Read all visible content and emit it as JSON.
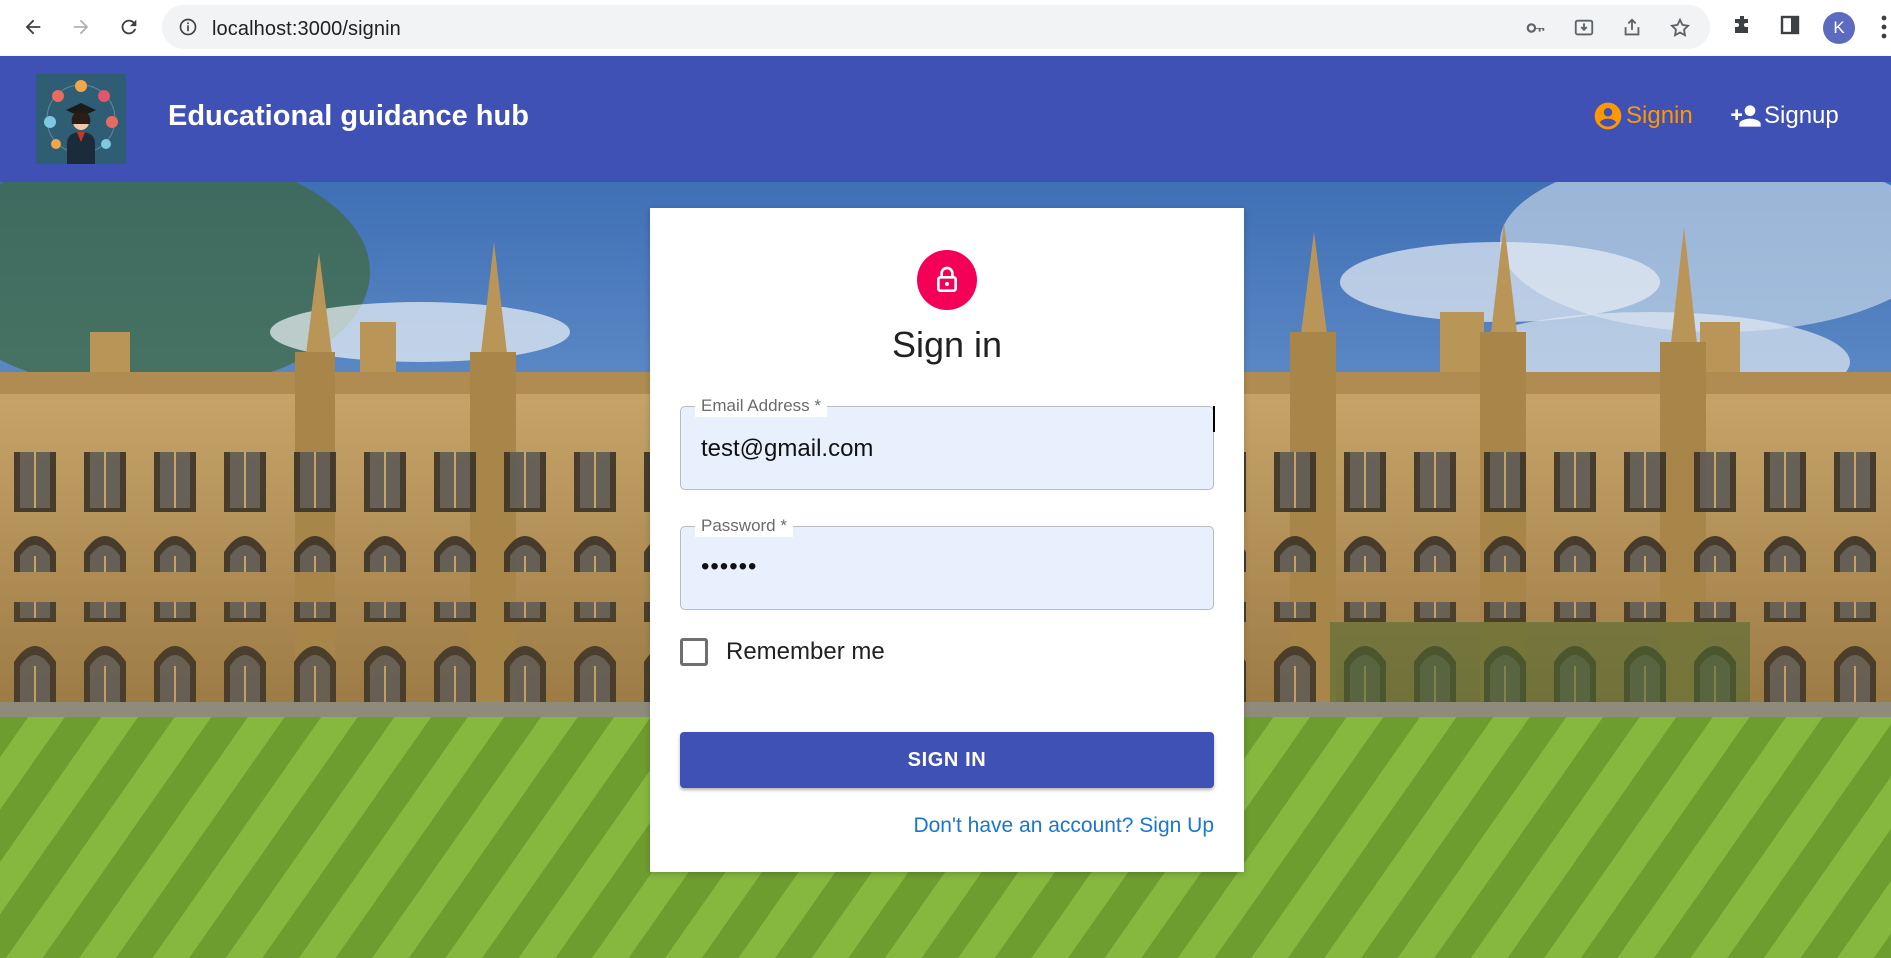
{
  "browser": {
    "url": "localhost:3000/signin",
    "profile_initial": "K"
  },
  "appbar": {
    "brand": "Educational guidance hub",
    "nav": {
      "signin_label": "Signin",
      "signup_label": "Signup"
    }
  },
  "signin_form": {
    "title": "Sign in",
    "email": {
      "label": "Email Address *",
      "value": "test@gmail.com"
    },
    "password": {
      "label": "Password *",
      "value": "••••••"
    },
    "remember_label": "Remember me",
    "remember_checked": false,
    "submit_label": "SIGN IN",
    "signup_link": "Don't have an account? Sign Up"
  },
  "colors": {
    "appbar": "#3f51b5",
    "active_nav": "#ff9800",
    "avatar": "#f50057",
    "link": "#1976d2",
    "autofill": "#e8f0fe"
  }
}
